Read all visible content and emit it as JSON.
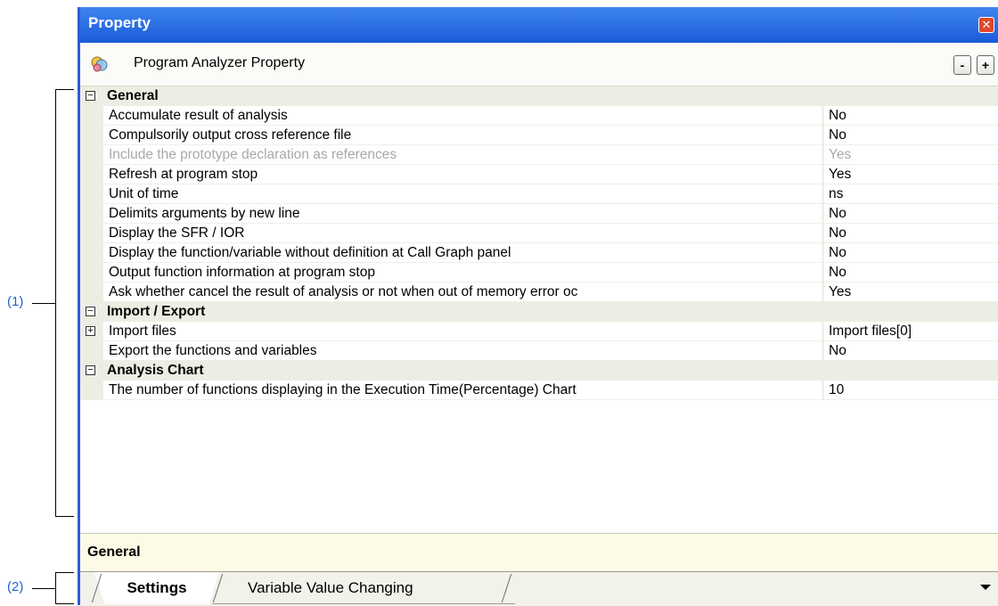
{
  "annotations": {
    "label1": "(1)",
    "label2": "(2)"
  },
  "window": {
    "title": "Property",
    "close_symbol": "✕"
  },
  "toolbar": {
    "title": "Program Analyzer Property",
    "collapse": "-",
    "expand": "+"
  },
  "categories": [
    {
      "label": "General",
      "expander": "−",
      "rows": [
        {
          "name": "Accumulate result of analysis",
          "value": "No"
        },
        {
          "name": "Compulsorily output cross reference file",
          "value": "No"
        },
        {
          "name": "Include the prototype declaration as references",
          "value": "Yes",
          "disabled": true
        },
        {
          "name": "Refresh at program stop",
          "value": "Yes"
        },
        {
          "name": "Unit of time",
          "value": "ns"
        },
        {
          "name": "Delimits arguments by new line",
          "value": "No"
        },
        {
          "name": "Display the SFR / IOR",
          "value": "No"
        },
        {
          "name": "Display the function/variable without definition at Call Graph panel",
          "value": "No"
        },
        {
          "name": "Output function information at program stop",
          "value": "No"
        },
        {
          "name": "Ask whether cancel the result of analysis or not when out of memory error oc",
          "value": "Yes"
        }
      ]
    },
    {
      "label": "Import / Export",
      "expander": "−",
      "rows": [
        {
          "name": "Import files",
          "value": "Import files[0]",
          "expander": "+"
        },
        {
          "name": "Export the functions and variables",
          "value": "No"
        }
      ]
    },
    {
      "label": "Analysis Chart",
      "expander": "−",
      "rows": [
        {
          "name": "The number of functions displaying in the Execution Time(Percentage) Chart",
          "value": "10"
        }
      ]
    }
  ],
  "description": {
    "title": "General"
  },
  "tabs": [
    {
      "label": "Settings",
      "active": true
    },
    {
      "label": "Variable Value Changing",
      "active": false
    }
  ]
}
